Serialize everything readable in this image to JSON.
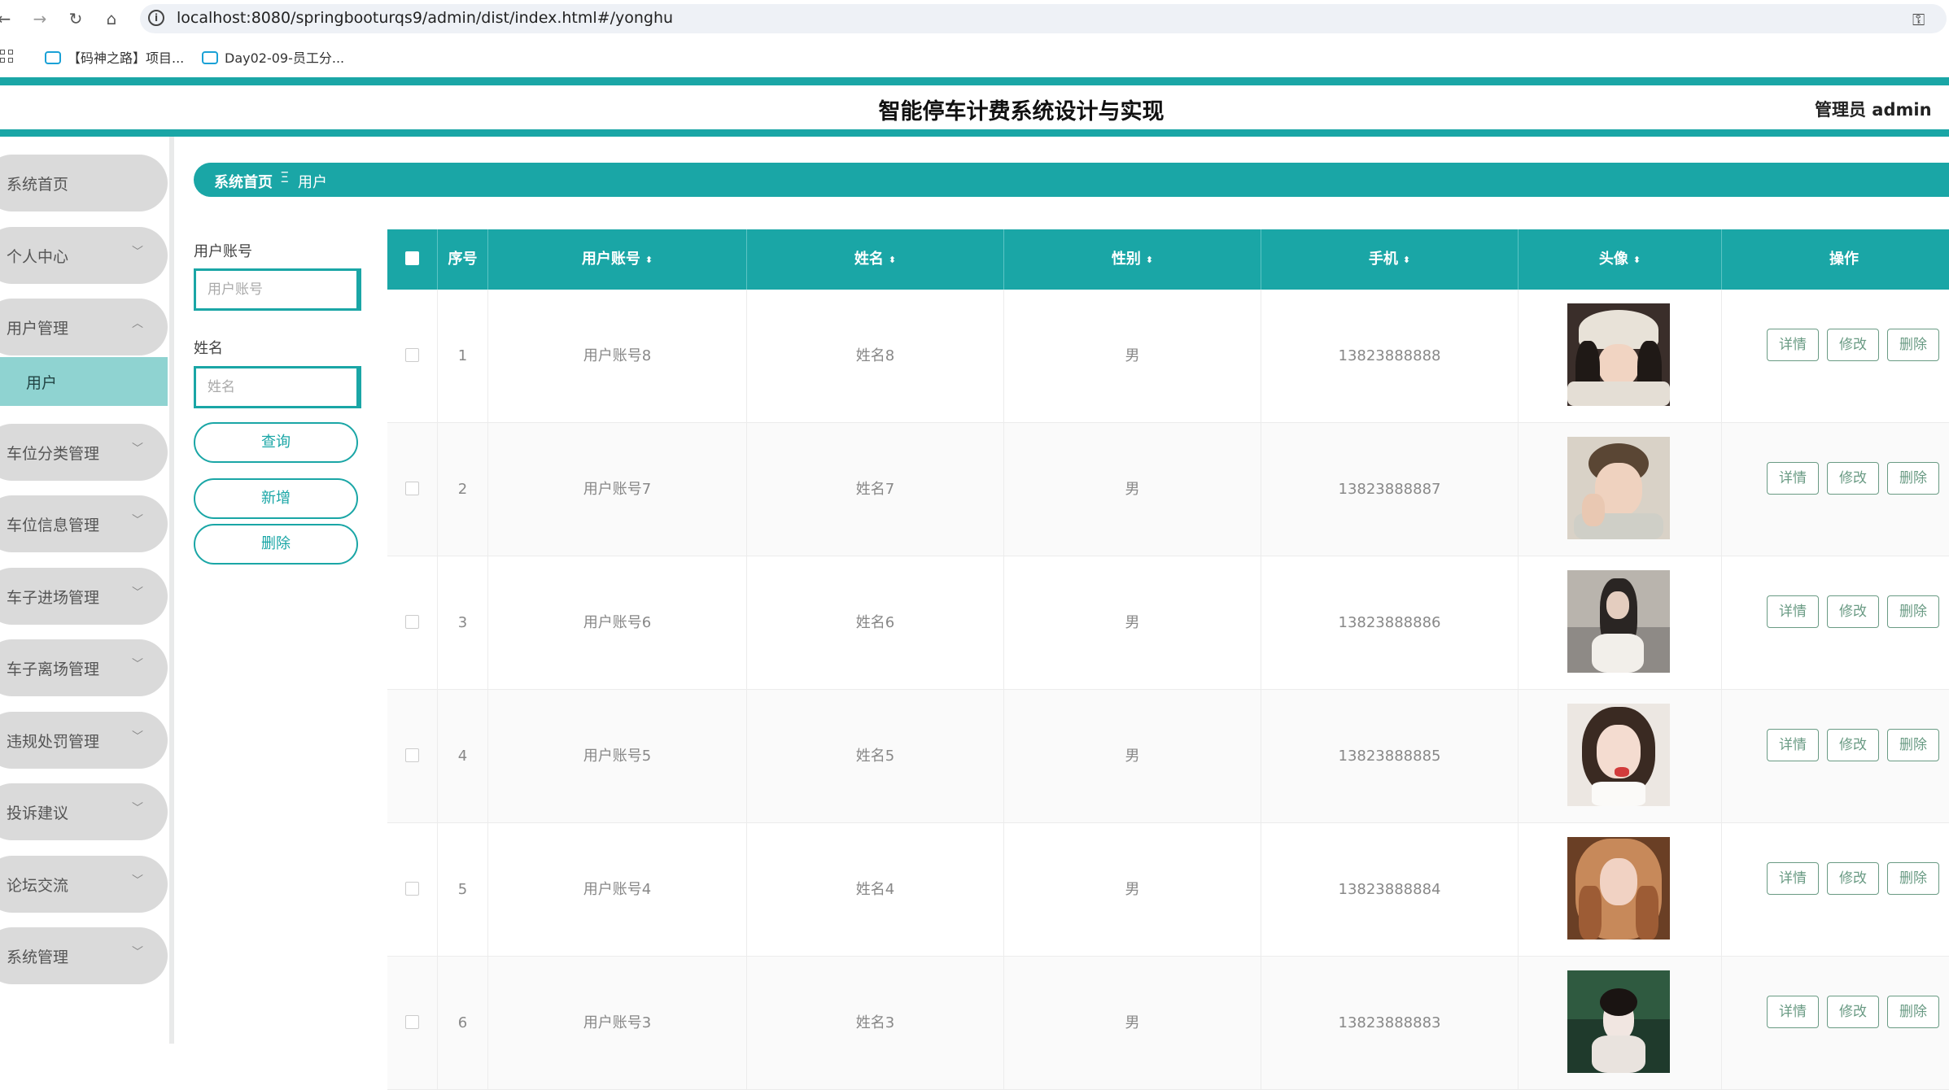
{
  "browser": {
    "url": "localhost:8080/springbooturqs9/admin/dist/index.html#/yonghu",
    "bookmarks": [
      "【码神之路】项目...",
      "Day02-09-员工分..."
    ]
  },
  "header": {
    "title": "智能停车计费系统设计与实现",
    "admin_label": "管理员 admin"
  },
  "colors": {
    "accent": "#1aa6a6",
    "sidebar_active": "#8fd3d1",
    "button_text": "#6a9b84"
  },
  "sidebar": {
    "items": [
      {
        "label": "系统首页",
        "icon": "none"
      },
      {
        "label": "个人中心",
        "icon": "chevron-down-icon"
      },
      {
        "label": "用户管理",
        "icon": "chevron-up-icon",
        "children": [
          {
            "label": "用户"
          }
        ]
      },
      {
        "label": "车位分类管理",
        "icon": "chevron-down-icon"
      },
      {
        "label": "车位信息管理",
        "icon": "chevron-down-icon"
      },
      {
        "label": "车子进场管理",
        "icon": "chevron-down-icon"
      },
      {
        "label": "车子离场管理",
        "icon": "chevron-down-icon"
      },
      {
        "label": "违规处罚管理",
        "icon": "chevron-down-icon"
      },
      {
        "label": "投诉建议",
        "icon": "chevron-down-icon"
      },
      {
        "label": "论坛交流",
        "icon": "chevron-down-icon"
      },
      {
        "label": "系统管理",
        "icon": "chevron-down-icon"
      }
    ]
  },
  "breadcrumb": {
    "home": "系统首页",
    "separator": "Ξ",
    "current": "用户"
  },
  "search": {
    "account_label": "用户账号",
    "account_placeholder": "用户账号",
    "account_value": "",
    "name_label": "姓名",
    "name_placeholder": "姓名",
    "name_value": "",
    "query_button": "查询",
    "add_button": "新增",
    "delete_button": "删除"
  },
  "table": {
    "columns": [
      "序号",
      "用户账号",
      "姓名",
      "性别",
      "手机",
      "头像",
      "操作"
    ],
    "actions": {
      "detail": "详情",
      "edit": "修改",
      "delete": "删除"
    },
    "rows": [
      {
        "index": "1",
        "account": "用户账号8",
        "name": "姓名8",
        "gender": "男",
        "phone": "13823888888",
        "avatar": "avatar-photo-8"
      },
      {
        "index": "2",
        "account": "用户账号7",
        "name": "姓名7",
        "gender": "男",
        "phone": "13823888887",
        "avatar": "avatar-photo-7"
      },
      {
        "index": "3",
        "account": "用户账号6",
        "name": "姓名6",
        "gender": "男",
        "phone": "13823888886",
        "avatar": "avatar-photo-6"
      },
      {
        "index": "4",
        "account": "用户账号5",
        "name": "姓名5",
        "gender": "男",
        "phone": "13823888885",
        "avatar": "avatar-photo-5"
      },
      {
        "index": "5",
        "account": "用户账号4",
        "name": "姓名4",
        "gender": "男",
        "phone": "13823888884",
        "avatar": "avatar-photo-4"
      },
      {
        "index": "6",
        "account": "用户账号3",
        "name": "姓名3",
        "gender": "男",
        "phone": "13823888883",
        "avatar": "avatar-photo-3"
      }
    ]
  }
}
